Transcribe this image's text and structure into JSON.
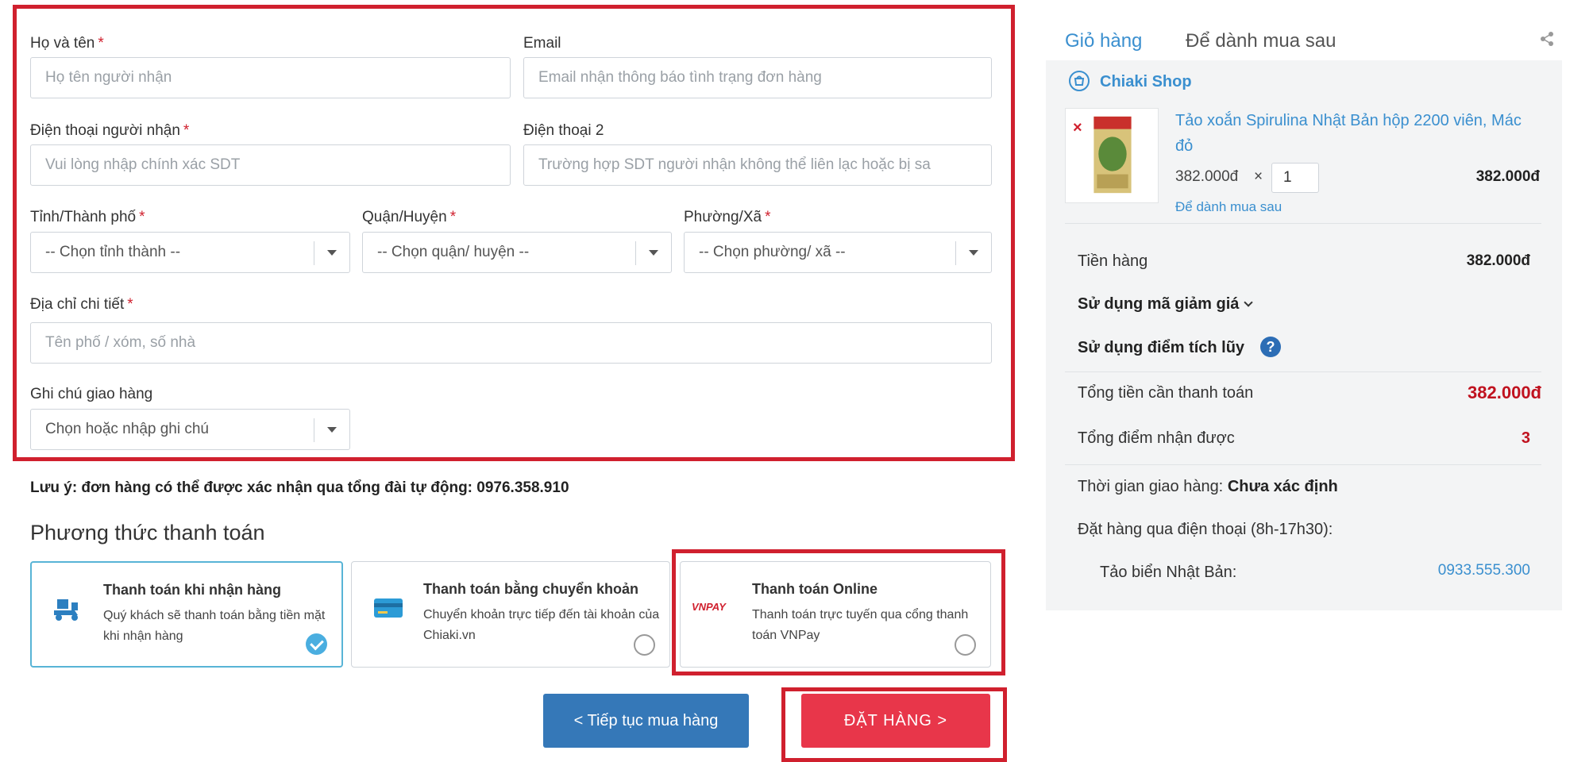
{
  "form": {
    "fullname": {
      "label": "Họ và tên",
      "required_mark": "*",
      "placeholder": "Họ tên người nhận"
    },
    "email": {
      "label": "Email",
      "placeholder": "Email nhận thông báo tình trạng đơn hàng"
    },
    "phone": {
      "label": "Điện thoại người nhận",
      "required_mark": "*",
      "placeholder": "Vui lòng nhập chính xác SDT"
    },
    "phone2": {
      "label": "Điện thoại 2",
      "placeholder": "Trường hợp SDT người nhận không thể liên lạc hoặc bị sa"
    },
    "city": {
      "label": "Tỉnh/Thành phố",
      "required_mark": "*",
      "value": "-- Chọn tỉnh thành --"
    },
    "district": {
      "label": "Quận/Huyện",
      "required_mark": "*",
      "value": "-- Chọn quận/ huyện --"
    },
    "ward": {
      "label": "Phường/Xã",
      "required_mark": "*",
      "value": "-- Chọn phường/ xã --"
    },
    "address": {
      "label": "Địa chỉ chi tiết",
      "required_mark": "*",
      "placeholder": "Tên phố / xóm, số nhà"
    },
    "delivery_note": {
      "label": "Ghi chú giao hàng",
      "value": "Chọn hoặc nhập ghi chú"
    }
  },
  "note_text": "Lưu ý: đơn hàng có thể được xác nhận qua tổng đài tự động: 0976.358.910",
  "payment": {
    "title": "Phương thức thanh toán",
    "options": [
      {
        "title": "Thanh toán khi nhận hàng",
        "desc": "Quý khách sẽ thanh toán bằng tiền mặt khi nhận hàng",
        "selected": true,
        "icon": "delivery-scooter-icon"
      },
      {
        "title": "Thanh toán bằng chuyển khoản",
        "desc": "Chuyển khoản trực tiếp đến tài khoản của Chiaki.vn",
        "selected": false,
        "icon": "bank-card-icon"
      },
      {
        "title": "Thanh toán Online",
        "desc": "Thanh toán trực tuyến qua cổng thanh toán VNPay",
        "selected": false,
        "icon": "vnpay-logo"
      }
    ],
    "vnpay_logo_text": "VNPAY"
  },
  "buttons": {
    "continue": "< Tiếp tục mua hàng",
    "order": "ĐẶT HÀNG >"
  },
  "cart": {
    "tabs": [
      "Giỏ hàng",
      "Để dành mua sau"
    ],
    "shop_name": "Chiaki Shop",
    "item": {
      "name": "Tảo xoắn Spirulina Nhật Bản hộp 2200 viên, Mác đỏ",
      "unit_price": "382.000đ",
      "times": "×",
      "quantity": "1",
      "line_total": "382.000đ",
      "save_later": "Để dành mua sau",
      "remove": "×"
    },
    "subtotal_label": "Tiền hàng",
    "subtotal_value": "382.000đ",
    "discount_label": "Sử dụng mã giảm giá",
    "points_label": "Sử dụng điểm tích lũy",
    "help": "?",
    "total_label": "Tổng tiền cần thanh toán",
    "total_value": "382.000đ",
    "earned_label": "Tổng điểm nhận được",
    "earned_value": "3",
    "delivery_time_label": "Thời gian giao hàng:",
    "delivery_time_value": "Chưa xác định",
    "phone_order_label": "Đặt hàng qua điện thoại (8h-17h30):",
    "phone_order_product": "Tảo biển Nhật Bản:",
    "phone_order_number": "0933.555.300"
  },
  "colors": {
    "highlight_red": "#d0202e",
    "link_blue": "#3a8fcf",
    "button_blue": "#3578b8",
    "button_red": "#e8364a",
    "price_red": "#c0121f"
  }
}
